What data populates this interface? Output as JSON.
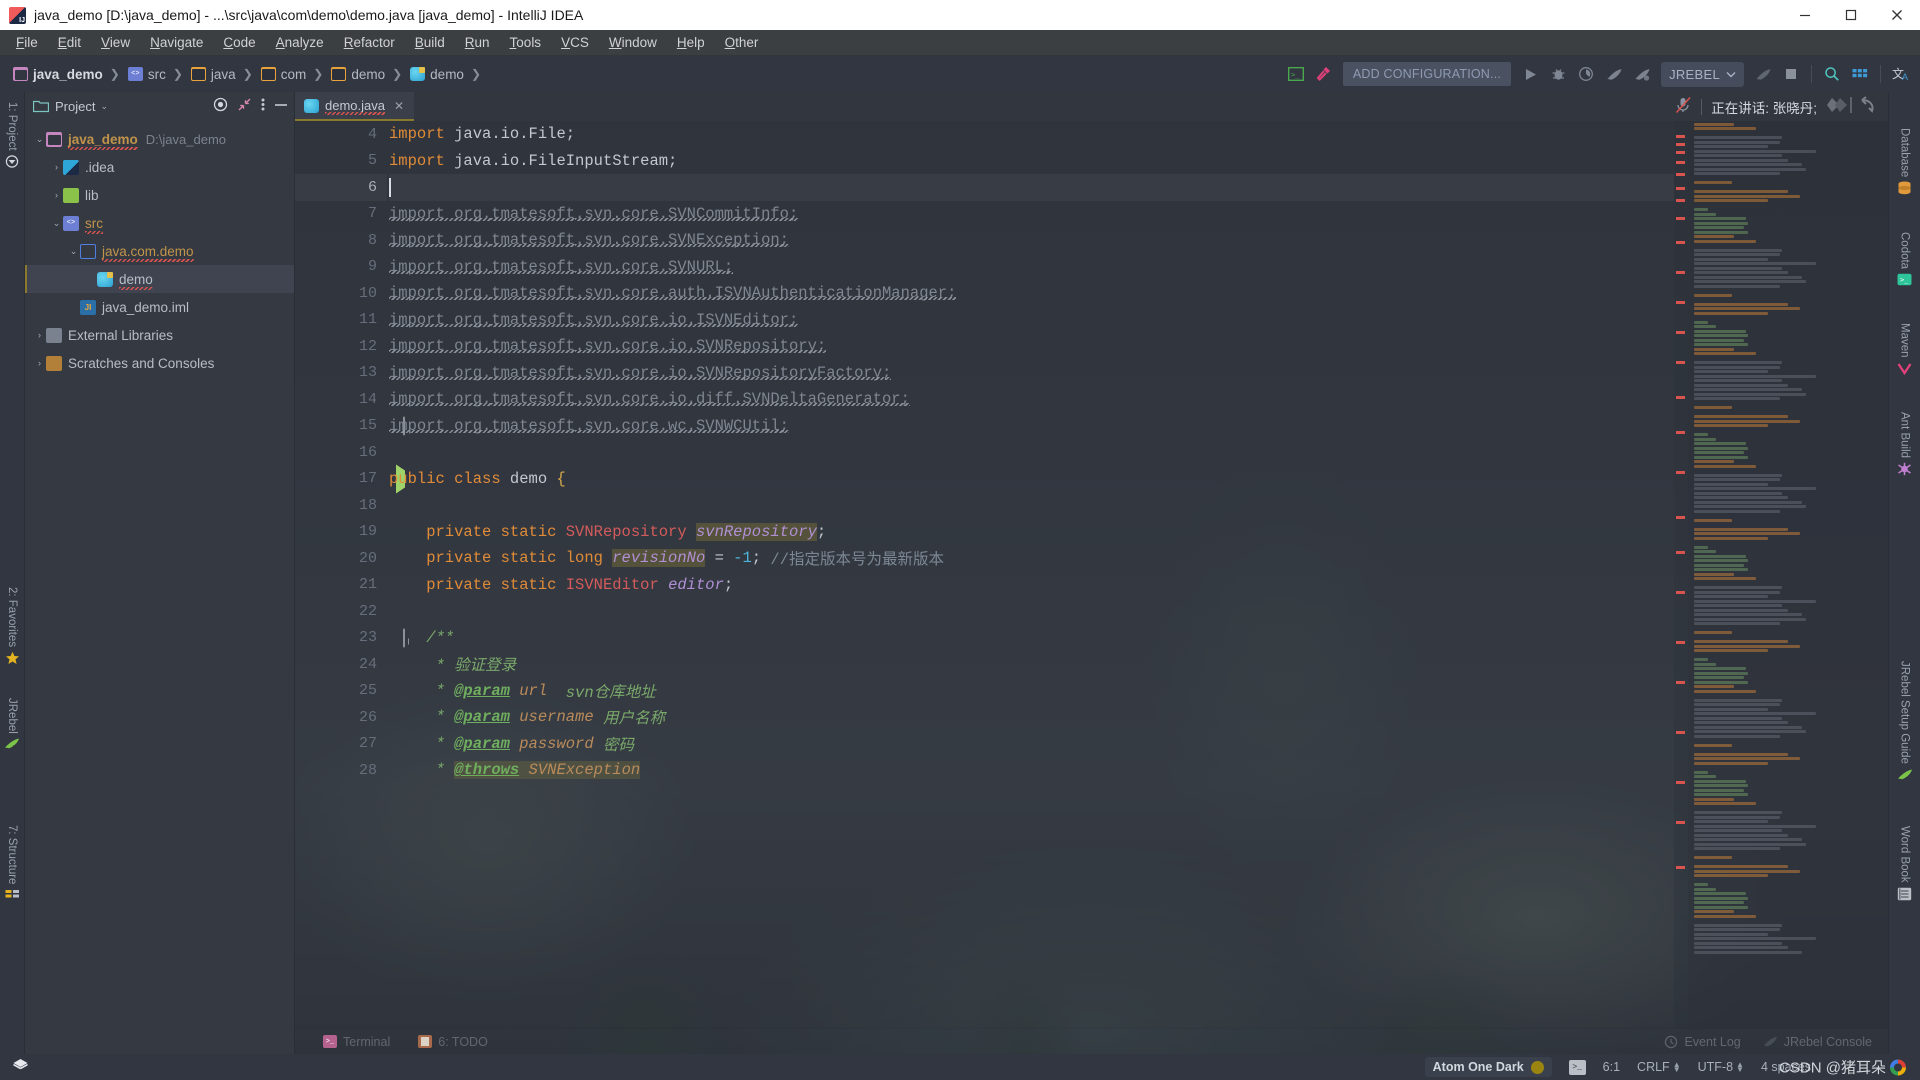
{
  "window": {
    "title": "java_demo [D:\\java_demo] - ...\\src\\java\\com\\demo\\demo.java [java_demo] - IntelliJ IDEA",
    "app_icon": "intellij-idea-icon",
    "minimize_label": "—",
    "maximize_label": "❐",
    "close_label": "✕"
  },
  "menubar": {
    "items": [
      {
        "label": "File"
      },
      {
        "label": "Edit"
      },
      {
        "label": "View"
      },
      {
        "label": "Navigate"
      },
      {
        "label": "Code"
      },
      {
        "label": "Analyze"
      },
      {
        "label": "Refactor"
      },
      {
        "label": "Build"
      },
      {
        "label": "Run"
      },
      {
        "label": "Tools"
      },
      {
        "label": "VCS"
      },
      {
        "label": "Window"
      },
      {
        "label": "Help"
      },
      {
        "label": "Other"
      }
    ]
  },
  "navbar": {
    "breadcrumbs": [
      {
        "label": "java_demo",
        "icon": "module-folder-icon",
        "bold": true
      },
      {
        "label": "src",
        "icon": "source-root-icon",
        "bold": false
      },
      {
        "label": "java",
        "icon": "folder-icon",
        "bold": false
      },
      {
        "label": "com",
        "icon": "folder-icon",
        "bold": false
      },
      {
        "label": "demo",
        "icon": "folder-icon",
        "bold": false
      },
      {
        "label": "demo",
        "icon": "java-class-icon",
        "bold": false
      }
    ],
    "separator": "❯",
    "add_configuration": "ADD CONFIGURATION...",
    "jrebel_label": "JREBEL",
    "jrebel_chevron": "⌄",
    "icons": [
      {
        "name": "terminal-toolbar-icon"
      },
      {
        "name": "build-hammer-icon"
      },
      {
        "name": "run-icon"
      },
      {
        "name": "debug-icon"
      },
      {
        "name": "run-with-coverage-icon"
      },
      {
        "name": "jrebel-run-icon"
      },
      {
        "name": "jrebel-debug-icon"
      },
      {
        "name": "jrebel-stop-icon"
      },
      {
        "name": "stop-icon"
      },
      {
        "name": "search-everywhere-icon"
      },
      {
        "name": "grid-icon"
      },
      {
        "name": "translate-icon"
      }
    ]
  },
  "left_rail": [
    {
      "label": "1: Project",
      "icon": "project-icon"
    },
    {
      "label": "2: Favorites",
      "icon": "star-icon"
    },
    {
      "label": "JRebel",
      "icon": "jrebel-icon"
    },
    {
      "label": "7: Structure",
      "icon": "structure-icon"
    }
  ],
  "right_rail": [
    {
      "label": "Database",
      "icon": "database-icon"
    },
    {
      "label": "Codota",
      "icon": "codota-icon"
    },
    {
      "label": "Maven",
      "icon": "maven-icon"
    },
    {
      "label": "Ant Build",
      "icon": "ant-build-icon"
    },
    {
      "label": "JRebel Setup Guide",
      "icon": "jrebel-guide-icon"
    },
    {
      "label": "Word Book",
      "icon": "word-book-icon"
    }
  ],
  "project_panel": {
    "title": "Project",
    "chevron": "⌄",
    "header_icons": [
      {
        "name": "locate-target-icon",
        "glyph": "◎"
      },
      {
        "name": "collapse-all-icon",
        "glyph": "↙"
      },
      {
        "name": "more-options-icon",
        "glyph": "⋮"
      },
      {
        "name": "hide-panel-icon",
        "glyph": "—"
      }
    ],
    "tree": [
      {
        "label": "java_demo",
        "path": "D:\\java_demo",
        "arrow": "⌄",
        "icon": "module-folder-icon",
        "indent": 0,
        "style": "bold-orange",
        "squiggly": true,
        "selected": false
      },
      {
        "label": ".idea",
        "path": "",
        "arrow": "›",
        "icon": "idea-folder-icon",
        "indent": 1,
        "style": "plain",
        "squiggly": false,
        "selected": false
      },
      {
        "label": "lib",
        "path": "",
        "arrow": "›",
        "icon": "lib-folder-icon",
        "indent": 1,
        "style": "plain",
        "squiggly": false,
        "selected": false
      },
      {
        "label": "src",
        "path": "",
        "arrow": "⌄",
        "icon": "source-root-icon",
        "indent": 1,
        "style": "orange",
        "squiggly": true,
        "selected": false
      },
      {
        "label": "java.com.demo",
        "path": "",
        "arrow": "⌄",
        "icon": "package-icon",
        "indent": 2,
        "style": "orange",
        "squiggly": true,
        "selected": false
      },
      {
        "label": "demo",
        "path": "",
        "arrow": "",
        "icon": "java-class-icon",
        "indent": 3,
        "style": "plain",
        "squiggly": true,
        "selected": true
      },
      {
        "label": "java_demo.iml",
        "path": "",
        "arrow": "",
        "icon": "iml-icon",
        "indent": 2,
        "style": "plain",
        "squiggly": false,
        "selected": false
      },
      {
        "label": "External Libraries",
        "path": "",
        "arrow": "›",
        "icon": "external-libraries-icon",
        "indent": 0,
        "style": "plain",
        "squiggly": false,
        "selected": false
      },
      {
        "label": "Scratches and Consoles",
        "path": "",
        "arrow": "›",
        "icon": "scratches-icon",
        "indent": 0,
        "style": "plain",
        "squiggly": false,
        "selected": false
      }
    ]
  },
  "editor": {
    "tab": {
      "label": "demo.java",
      "icon": "java-class-icon",
      "close": "✕"
    },
    "speaking_status": "正在讲话: 张晓丹;",
    "mic_icon": "mic-muted-icon",
    "lines": [
      {
        "num": "4",
        "current": false,
        "mark": "",
        "segments": [
          {
            "t": "import ",
            "c": "kw"
          },
          {
            "t": "java.io.File;",
            "c": "plain"
          }
        ]
      },
      {
        "num": "5",
        "current": false,
        "mark": "",
        "segments": [
          {
            "t": "import ",
            "c": "kw"
          },
          {
            "t": "java.io.FileInputStream;",
            "c": "plain"
          }
        ]
      },
      {
        "num": "6",
        "current": true,
        "mark": "",
        "segments": [
          {
            "t": "",
            "c": "caret"
          }
        ]
      },
      {
        "num": "7",
        "current": false,
        "mark": "",
        "segments": [
          {
            "t": "import org.",
            "c": "unused"
          },
          {
            "t": "tmatesoft",
            "c": "unusedred"
          },
          {
            "t": ".svn.core.SVNCommitInfo;",
            "c": "unused"
          }
        ]
      },
      {
        "num": "8",
        "current": false,
        "mark": "",
        "segments": [
          {
            "t": "import org.",
            "c": "unused"
          },
          {
            "t": "tmatesoft",
            "c": "unusedred"
          },
          {
            "t": ".svn.core.SVNException;",
            "c": "unused"
          }
        ]
      },
      {
        "num": "9",
        "current": false,
        "mark": "",
        "segments": [
          {
            "t": "import org.",
            "c": "unused"
          },
          {
            "t": "tmatesoft",
            "c": "unusedred"
          },
          {
            "t": ".svn.core.SVNURL;",
            "c": "unused"
          }
        ]
      },
      {
        "num": "10",
        "current": false,
        "mark": "",
        "segments": [
          {
            "t": "import org.",
            "c": "unused"
          },
          {
            "t": "tmatesoft",
            "c": "unusedred"
          },
          {
            "t": ".svn.core.auth.ISVNAuthenticationManager;",
            "c": "unused"
          }
        ]
      },
      {
        "num": "11",
        "current": false,
        "mark": "",
        "segments": [
          {
            "t": "import org.",
            "c": "unused"
          },
          {
            "t": "tmatesoft",
            "c": "unusedred"
          },
          {
            "t": ".svn.core.io.ISVNEditor;",
            "c": "unused"
          }
        ]
      },
      {
        "num": "12",
        "current": false,
        "mark": "",
        "segments": [
          {
            "t": "import org.",
            "c": "unused"
          },
          {
            "t": "tmatesoft",
            "c": "unusedred"
          },
          {
            "t": ".svn.core.io.SVNRepository;",
            "c": "unused"
          }
        ]
      },
      {
        "num": "13",
        "current": false,
        "mark": "",
        "segments": [
          {
            "t": "import org.",
            "c": "unused"
          },
          {
            "t": "tmatesoft",
            "c": "unusedred"
          },
          {
            "t": ".svn.core.io.SVNRepositoryFactory;",
            "c": "unused"
          }
        ]
      },
      {
        "num": "14",
        "current": false,
        "mark": "",
        "segments": [
          {
            "t": "import org.",
            "c": "unused"
          },
          {
            "t": "tmatesoft",
            "c": "unusedred"
          },
          {
            "t": ".svn.core.io.diff.SVNDeltaGenerator;",
            "c": "unused"
          }
        ]
      },
      {
        "num": "15",
        "current": false,
        "mark": "fold",
        "segments": [
          {
            "t": "import org.",
            "c": "unused"
          },
          {
            "t": "tmatesoft",
            "c": "unusedred"
          },
          {
            "t": ".svn.core.wc.SVNWCUtil;",
            "c": "unused"
          }
        ]
      },
      {
        "num": "16",
        "current": false,
        "mark": "",
        "segments": []
      },
      {
        "num": "17",
        "current": false,
        "mark": "run",
        "segments": [
          {
            "t": "public class ",
            "c": "kw"
          },
          {
            "t": "demo",
            "c": "plain"
          },
          {
            "t": " {",
            "c": "brace"
          }
        ]
      },
      {
        "num": "18",
        "current": false,
        "mark": "",
        "segments": []
      },
      {
        "num": "19",
        "current": false,
        "mark": "",
        "segments": [
          {
            "t": "    private static ",
            "c": "kw"
          },
          {
            "t": "SVNRepository",
            "c": "type"
          },
          {
            "t": " ",
            "c": "plain"
          },
          {
            "t": "svnRepository",
            "c": "field-hl"
          },
          {
            "t": ";",
            "c": "plain"
          }
        ]
      },
      {
        "num": "20",
        "current": false,
        "mark": "",
        "segments": [
          {
            "t": "    private static long ",
            "c": "kw"
          },
          {
            "t": "revisionNo",
            "c": "field-hl"
          },
          {
            "t": " = ",
            "c": "plain"
          },
          {
            "t": "-1",
            "c": "num"
          },
          {
            "t": "; ",
            "c": "plain"
          },
          {
            "t": "//指定版本号为最新版本",
            "c": "comment"
          }
        ]
      },
      {
        "num": "21",
        "current": false,
        "mark": "",
        "segments": [
          {
            "t": "    private static ",
            "c": "kw"
          },
          {
            "t": "ISVNEditor",
            "c": "type"
          },
          {
            "t": " ",
            "c": "plain"
          },
          {
            "t": "editor",
            "c": "field"
          },
          {
            "t": ";",
            "c": "plain"
          }
        ]
      },
      {
        "num": "22",
        "current": false,
        "mark": "",
        "segments": []
      },
      {
        "num": "23",
        "current": false,
        "mark": "fold-open",
        "segments": [
          {
            "t": "    /**",
            "c": "doc"
          }
        ]
      },
      {
        "num": "24",
        "current": false,
        "mark": "",
        "segments": [
          {
            "t": "     * 验证登录",
            "c": "doc"
          }
        ]
      },
      {
        "num": "25",
        "current": false,
        "mark": "",
        "segments": [
          {
            "t": "     * ",
            "c": "doc"
          },
          {
            "t": "@param",
            "c": "docbold"
          },
          {
            "t": " url",
            "c": "docparam"
          },
          {
            "t": "  svn仓库地址",
            "c": "doc"
          }
        ]
      },
      {
        "num": "26",
        "current": false,
        "mark": "",
        "segments": [
          {
            "t": "     * ",
            "c": "doc"
          },
          {
            "t": "@param",
            "c": "docbold"
          },
          {
            "t": " username",
            "c": "docparam"
          },
          {
            "t": " 用户名称",
            "c": "doc"
          }
        ]
      },
      {
        "num": "27",
        "current": false,
        "mark": "",
        "segments": [
          {
            "t": "     * ",
            "c": "doc"
          },
          {
            "t": "@param",
            "c": "docbold"
          },
          {
            "t": " password",
            "c": "docparam"
          },
          {
            "t": " 密码",
            "c": "doc"
          }
        ]
      },
      {
        "num": "28",
        "current": false,
        "mark": "",
        "segments": [
          {
            "t": "     * ",
            "c": "doc"
          },
          {
            "t": "@throws",
            "c": "docbold-hl"
          },
          {
            "t": " SVNException",
            "c": "docparam-hl"
          }
        ]
      }
    ]
  },
  "bottom_bar": {
    "left": [
      {
        "label": "Terminal",
        "icon": "terminal-icon"
      },
      {
        "label": "6: TODO",
        "icon": "todo-icon"
      }
    ],
    "right": [
      {
        "label": "Event Log",
        "icon": "event-log-icon"
      },
      {
        "label": "JRebel Console",
        "icon": "jrebel-console-icon"
      }
    ]
  },
  "statusbar": {
    "left_icon": "layers-icon",
    "theme": "Atom One Dark",
    "theme_color": "#9a8510",
    "terminal_icon": "terminal-status-icon",
    "caret_position": "6:1",
    "line_separator": "CRLF",
    "encoding": "UTF-8",
    "indent": "4 spaces",
    "watermark": "CSDN @猪耳朵"
  }
}
